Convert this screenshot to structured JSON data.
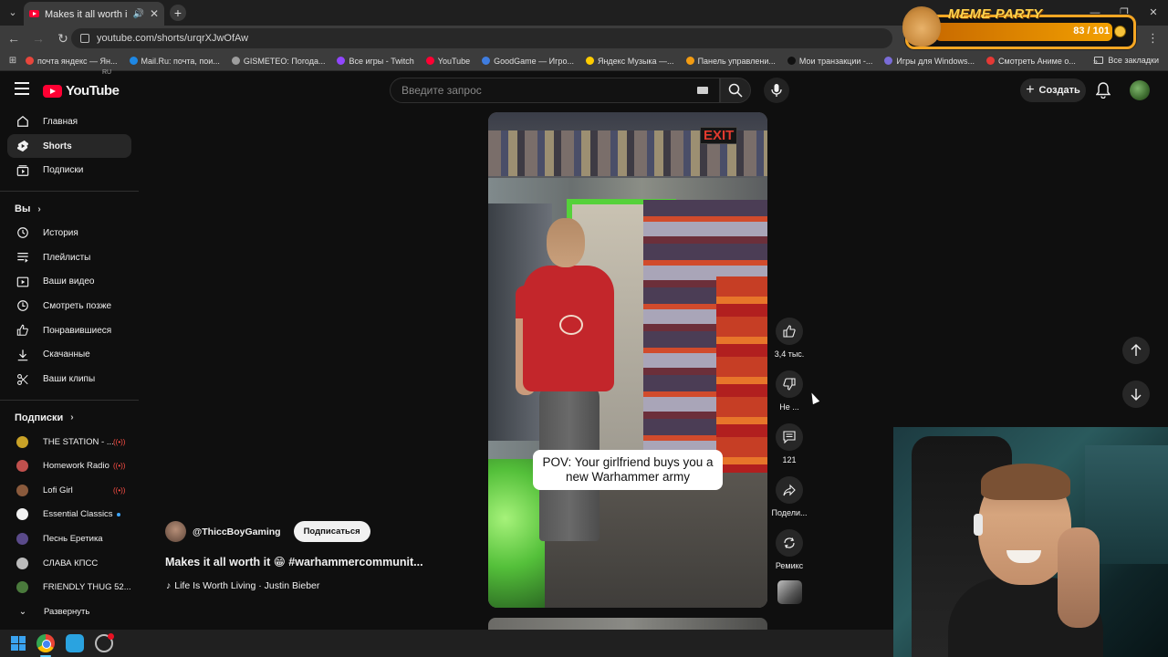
{
  "browser": {
    "tab": {
      "title": "Makes it all worth it 😁 #w"
    },
    "url": "youtube.com/shorts/urqrXJwOfAw",
    "bookmarks": [
      {
        "label": "почта яндекс — Ян...",
        "color": "#e8463c"
      },
      {
        "label": "Mail.Ru: почта, пои...",
        "color": "#1e88e5"
      },
      {
        "label": "GISMETEO: Погода...",
        "color": "#9e9e9e"
      },
      {
        "label": "Все игры - Twitch",
        "color": "#9146ff"
      },
      {
        "label": "YouTube",
        "color": "#ff0033"
      },
      {
        "label": "GoodGame — Игро...",
        "color": "#3f7de0"
      },
      {
        "label": "Яндекс Музыка —...",
        "color": "#ffcc00"
      },
      {
        "label": "Панель управлени...",
        "color": "#f39c12"
      },
      {
        "label": "Мои транзакции -...",
        "color": "#111111"
      },
      {
        "label": "Игры для Windows...",
        "color": "#7a6cd8"
      },
      {
        "label": "Смотреть Аниме о...",
        "color": "#e53935"
      }
    ],
    "all_bookmarks": "Все закладки"
  },
  "meme_party": {
    "title": "MEME PARTY",
    "progress": "83 / 101",
    "fraction": 0.82
  },
  "youtube": {
    "logo": "YouTube",
    "region": "RU",
    "search_placeholder": "Введите запрос",
    "create_label": "Создать",
    "sidebar": {
      "main": [
        {
          "label": "Главная",
          "icon": "home-icon"
        },
        {
          "label": "Shorts",
          "icon": "shorts-icon",
          "active": true
        },
        {
          "label": "Подписки",
          "icon": "subscriptions-icon"
        }
      ],
      "you_header": "Вы",
      "you": [
        {
          "label": "История",
          "icon": "history-icon"
        },
        {
          "label": "Плейлисты",
          "icon": "playlists-icon"
        },
        {
          "label": "Ваши видео",
          "icon": "your-videos-icon"
        },
        {
          "label": "Смотреть позже",
          "icon": "watch-later-icon"
        },
        {
          "label": "Понравившиеся",
          "icon": "liked-icon"
        },
        {
          "label": "Скачанные",
          "icon": "downloads-icon"
        },
        {
          "label": "Ваши клипы",
          "icon": "clips-icon"
        }
      ],
      "subs_header": "Подписки",
      "subs": [
        {
          "label": "THE STATION - ...",
          "color": "#c9a227",
          "badge": "live"
        },
        {
          "label": "Homework Radio",
          "color": "#c0504d",
          "badge": "live"
        },
        {
          "label": "Lofi Girl",
          "color": "#8a5a3c",
          "badge": "live"
        },
        {
          "label": "Essential Classics",
          "color": "#f1f1f1",
          "badge": "new"
        },
        {
          "label": "Песнь Еретика",
          "color": "#5a4a8a",
          "badge": ""
        },
        {
          "label": "СЛАВА КПСС",
          "color": "#bbbbbb",
          "badge": ""
        },
        {
          "label": "FRIENDLY THUG 52...",
          "color": "#4a7a3c",
          "badge": ""
        }
      ],
      "expand": "Развернуть"
    },
    "short": {
      "caption": "POV: Your girlfriend buys you a new Warhammer army",
      "exit_sign": "EXIT",
      "channel": "@ThiccBoyGaming",
      "subscribe": "Подписаться",
      "title": "Makes it all worth it 😁 #warhammercommunit...",
      "sound": "Life Is Worth Living · Justin Bieber",
      "actions": {
        "likes": "3,4 тыс.",
        "dislike": "Не ...",
        "comments": "121",
        "share": "Подели...",
        "remix": "Ремикс"
      }
    }
  }
}
